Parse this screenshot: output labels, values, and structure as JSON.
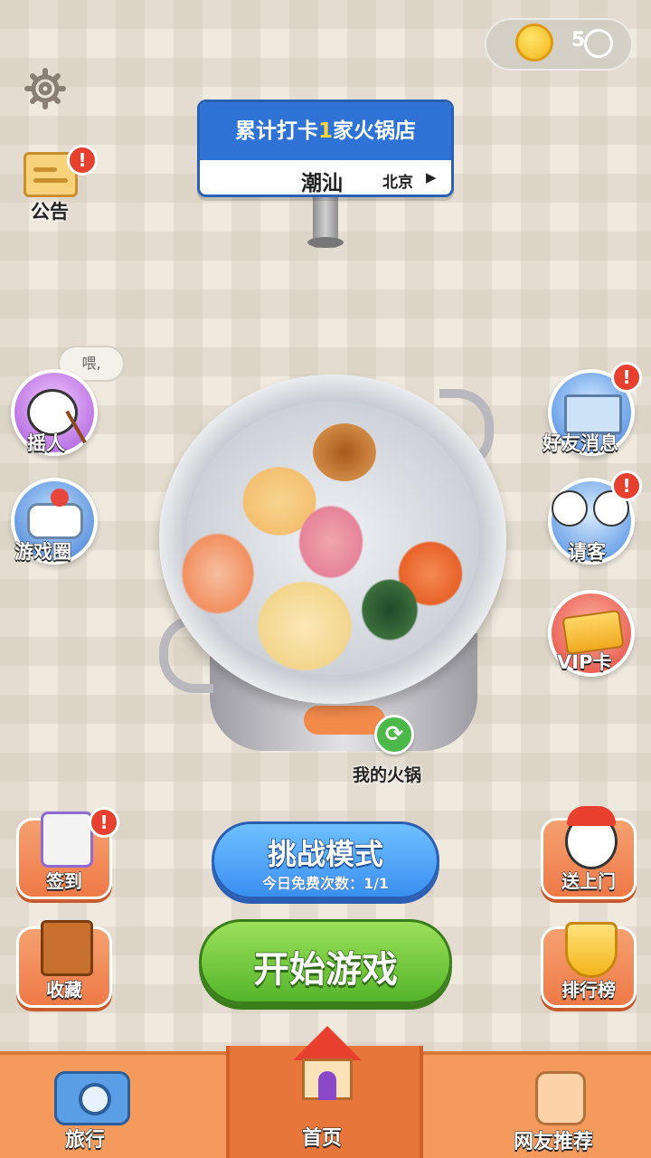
{
  "coins": {
    "value": "5"
  },
  "settings": {
    "label": ""
  },
  "notice": {
    "label": "公告"
  },
  "sign": {
    "title_prefix": "累计打卡",
    "title_count": "1",
    "title_suffix": "家火锅店",
    "region": "潮汕",
    "city": "北京",
    "arrow": "▶"
  },
  "speech": {
    "text": "喂,"
  },
  "left_buttons": {
    "shake": "摇人",
    "circle": "游戏圈"
  },
  "right_buttons": {
    "friend_msg": "好友消息",
    "treat": "请客",
    "vip": "VIP卡"
  },
  "pot": {
    "label": "我的火锅"
  },
  "checkin": {
    "label": "签到"
  },
  "favorites": {
    "label": "收藏"
  },
  "delivery": {
    "label": "送上门"
  },
  "ranking": {
    "label": "排行榜"
  },
  "challenge": {
    "title": "挑战模式",
    "subtitle": "今日免费次数：1/1"
  },
  "start": {
    "label": "开始游戏"
  },
  "badge_mark": "!",
  "nav": {
    "travel": "旅行",
    "home": "首页",
    "recommend": "网友推荐"
  }
}
